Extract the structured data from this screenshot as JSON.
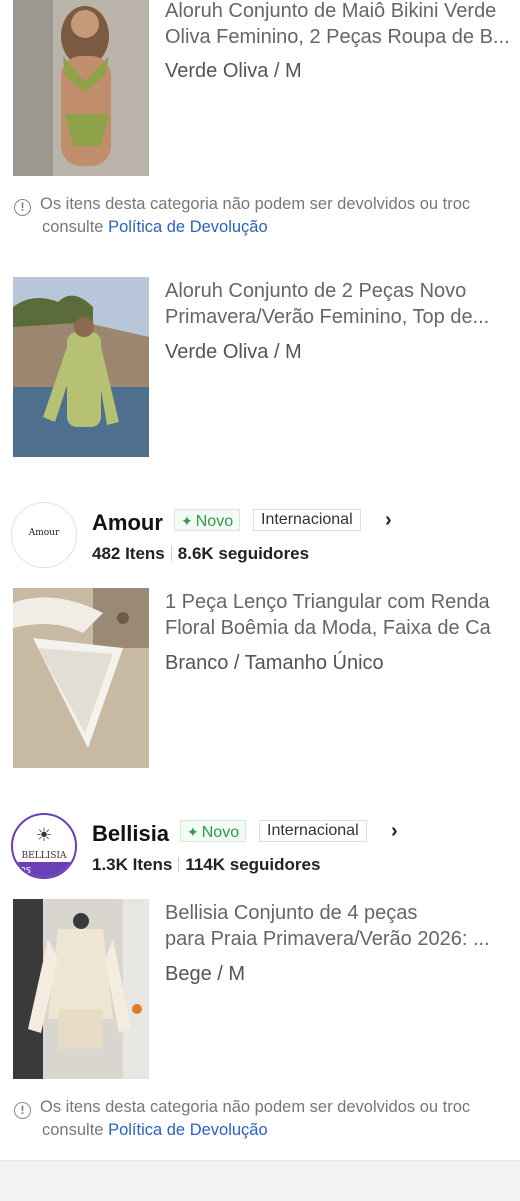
{
  "products": [
    {
      "title_line1": "Aloruh Conjunto de Maiô Bikini Verde",
      "title_line2": "Oliva Feminino, 2 Peças Roupa de B...",
      "variant": "Verde Oliva / M"
    },
    {
      "title_line1": "Aloruh Conjunto de 2 Peças Novo",
      "title_line2": "Primavera/Verão Feminino, Top de...",
      "variant": "Verde Oliva / M"
    },
    {
      "title_line1": "1 Peça Lenço Triangular com Renda",
      "title_line2": "Floral Boêmia da Moda, Faixa de Ca",
      "variant": "Branco / Tamanho Único"
    },
    {
      "title_line1": "Bellisia Conjunto de 4 peças",
      "title_line2": "para Praia Primavera/Verão 2026: ...",
      "variant": "Bege / M"
    }
  ],
  "notice": {
    "line1": "Os itens desta categoria não podem ser devolvidos ou troc",
    "line2_prefix": "consulte",
    "link": "Política de Devolução",
    "icon": "info-icon"
  },
  "stores": [
    {
      "name": "Amour",
      "logo_text": "Amour",
      "new_badge": "Novo",
      "intl_badge": "Internacional",
      "items": "482 Itens",
      "followers": "8.6K seguidores"
    },
    {
      "name": "Bellisia",
      "logo_text": "BELLISIA",
      "logo_banner": "ias",
      "new_badge": "Novo",
      "intl_badge": "Internacional",
      "items": "1.3K Itens",
      "followers": "114K seguidores"
    }
  ],
  "colors": {
    "link": "#2962c4",
    "new_badge": "#2f9b4a",
    "bellisia_purple": "#6a3fb8"
  }
}
